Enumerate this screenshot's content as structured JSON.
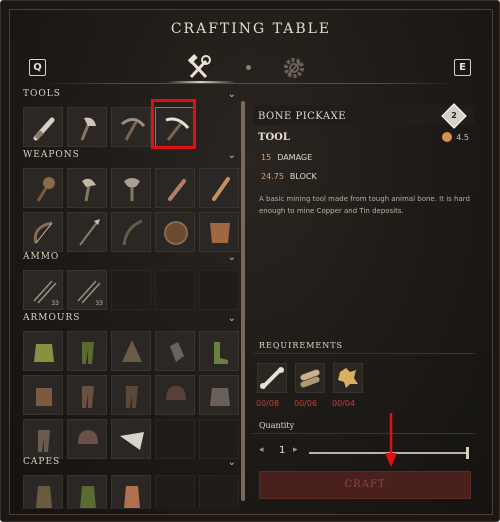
{
  "window": {
    "title": "CRAFTING TABLE",
    "left_key": "Q",
    "right_key": "E"
  },
  "tabs": [
    {
      "name": "crafting",
      "icon": "hammer-wrench-icon",
      "active": true
    },
    {
      "name": "settings",
      "icon": "gear-icon",
      "active": false
    }
  ],
  "sections": [
    {
      "label": "TOOLS",
      "slots": 4
    },
    {
      "label": "WEAPONS",
      "slots": 10
    },
    {
      "label": "AMMO",
      "slots": 2,
      "counts": [
        "33",
        "33"
      ]
    },
    {
      "label": "ARMOURS",
      "slots": 15
    },
    {
      "label": "CAPES",
      "slots": 3
    }
  ],
  "selected": {
    "name": "BONE PICKAXE",
    "tier": "2",
    "type": "TOOL",
    "weight": "4.5",
    "stats": [
      {
        "value": "15",
        "label": "DAMAGE"
      },
      {
        "value": "24.75",
        "label": "BLOCK"
      }
    ],
    "description": "A basic mining tool made from tough animal bone. It is hard enough to mine Copper and Tin deposits."
  },
  "requirements": {
    "title": "REQUIREMENTS",
    "items": [
      {
        "icon": "bone-icon",
        "count": "00/08"
      },
      {
        "icon": "wood-log-icon",
        "count": "00/06"
      },
      {
        "icon": "hide-icon",
        "count": "00/04"
      }
    ]
  },
  "quantity": {
    "label": "Quantity",
    "value": "1",
    "minus": "◂",
    "plus": "▸"
  },
  "craft_button": {
    "label": "CRAFT",
    "enabled": false
  },
  "colors": {
    "accent": "#d8a070",
    "error": "#c0413a",
    "highlight": "#e01010"
  }
}
